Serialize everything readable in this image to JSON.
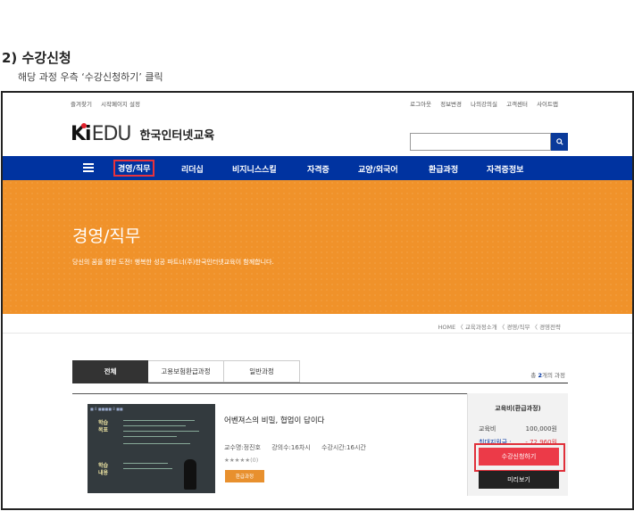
{
  "instructions": {
    "step_title": "2) 수강신청",
    "step_desc": "해당 과정 우측 ‘수강신청하기’ 클릭"
  },
  "topbar": {
    "left": [
      "즐겨찾기",
      "시작페이지 설정"
    ],
    "right": [
      "로그아웃",
      "정보변경",
      "나의강의실",
      "고객센터",
      "사이트맵"
    ]
  },
  "brand": {
    "logo_k": "Ki",
    "logo_edu": "EDU",
    "name": "한국인터넷교육",
    "logo_dot_color": "#e0202c"
  },
  "search": {
    "placeholder": "",
    "button_icon": "search-icon"
  },
  "nav": {
    "menu_icon": "hamburger-icon",
    "items": [
      "경영/직무",
      "리더십",
      "비지니스스킬",
      "자격증",
      "교양/외국어",
      "환급과정",
      "자격증정보"
    ],
    "active_index": 0,
    "bg_color": "#0033a0"
  },
  "hero": {
    "title": "경영/직무",
    "subtitle": "당신의 꿈을 향한 도전! 행복한 성공 파트너(주)한국인터넷교육이 함께합니다.",
    "bg_color": "#f0922a"
  },
  "breadcrumb": "HOME 〈 교육과정소개 〈 경영/직무 〈 경영전략",
  "tabs": [
    "전체",
    "고용보험환급과정",
    "일반과정"
  ],
  "count": {
    "prefix": "총 ",
    "number": "2",
    "suffix": "개의 과정"
  },
  "course": {
    "thumb": {
      "header": "■ 8 ■■■■ 8 ■■",
      "label1": "학습\n목표",
      "label2": "학습\n내용"
    },
    "title": "어벤져스의 비밀, 협업이 답이다",
    "instructor": "교수명:정진호",
    "lessons": "강의수:16차시",
    "hours": "수강시간:16시간",
    "stars": "★★★★★(0)",
    "badge": "환급과정",
    "price_title": "교육비(환급과정)",
    "fee_label": "교육비",
    "fee_value": "100,000원",
    "refund_label": "최대지원금 :",
    "refund_value": "- 72,960원",
    "apply_label": "수강신청하기",
    "preview_label": "미리보기",
    "apply_color": "#ec3a48"
  }
}
